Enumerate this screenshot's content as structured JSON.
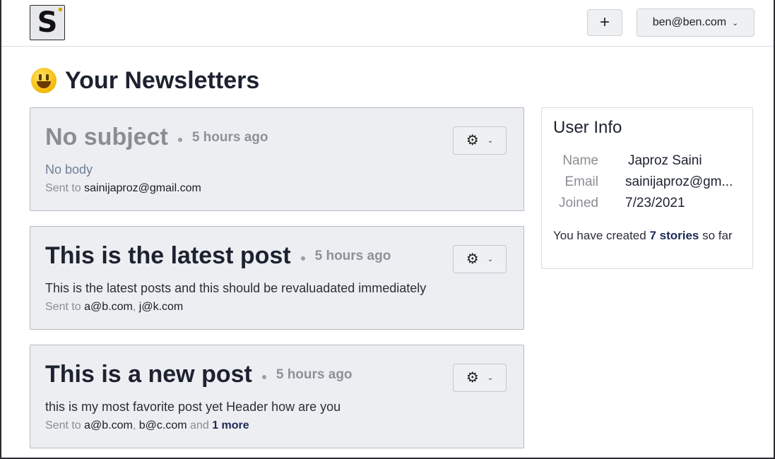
{
  "header": {
    "logo_letter": "S",
    "add_label": "+",
    "user_email": "ben@ben.com"
  },
  "page": {
    "title": "Your Newsletters"
  },
  "posts": [
    {
      "title": "No subject",
      "time": "5 hours ago",
      "body": "No body",
      "sent_label": "Sent to",
      "recipients": [
        "sainijaproz@gmail.com"
      ],
      "more": ""
    },
    {
      "title": "This is the latest post",
      "time": "5 hours ago",
      "body": "This is the latest posts and this should be revaluadated immediately",
      "sent_label": "Sent to",
      "recipients": [
        "a@b.com",
        "j@k.com"
      ],
      "more": ""
    },
    {
      "title": "This is a new post",
      "time": "5 hours ago",
      "body": "this is my most favorite post yet Header how are you",
      "sent_label": "Sent to",
      "recipients": [
        "a@b.com",
        "b@c.com"
      ],
      "more_prefix": "and",
      "more": "1 more"
    }
  ],
  "user_info": {
    "title": "User Info",
    "name_label": "Name",
    "name": "Japroz Saini",
    "email_label": "Email",
    "email": "sainijaproz@gm...",
    "joined_label": "Joined",
    "joined": "7/23/2021",
    "created_prefix": "You have created",
    "created_count": "7 stories",
    "created_suffix": "so far"
  },
  "icons": {
    "gear": "gear-icon",
    "chevron": "chevron-down-icon",
    "emoji": "smiley-emoji-icon"
  }
}
